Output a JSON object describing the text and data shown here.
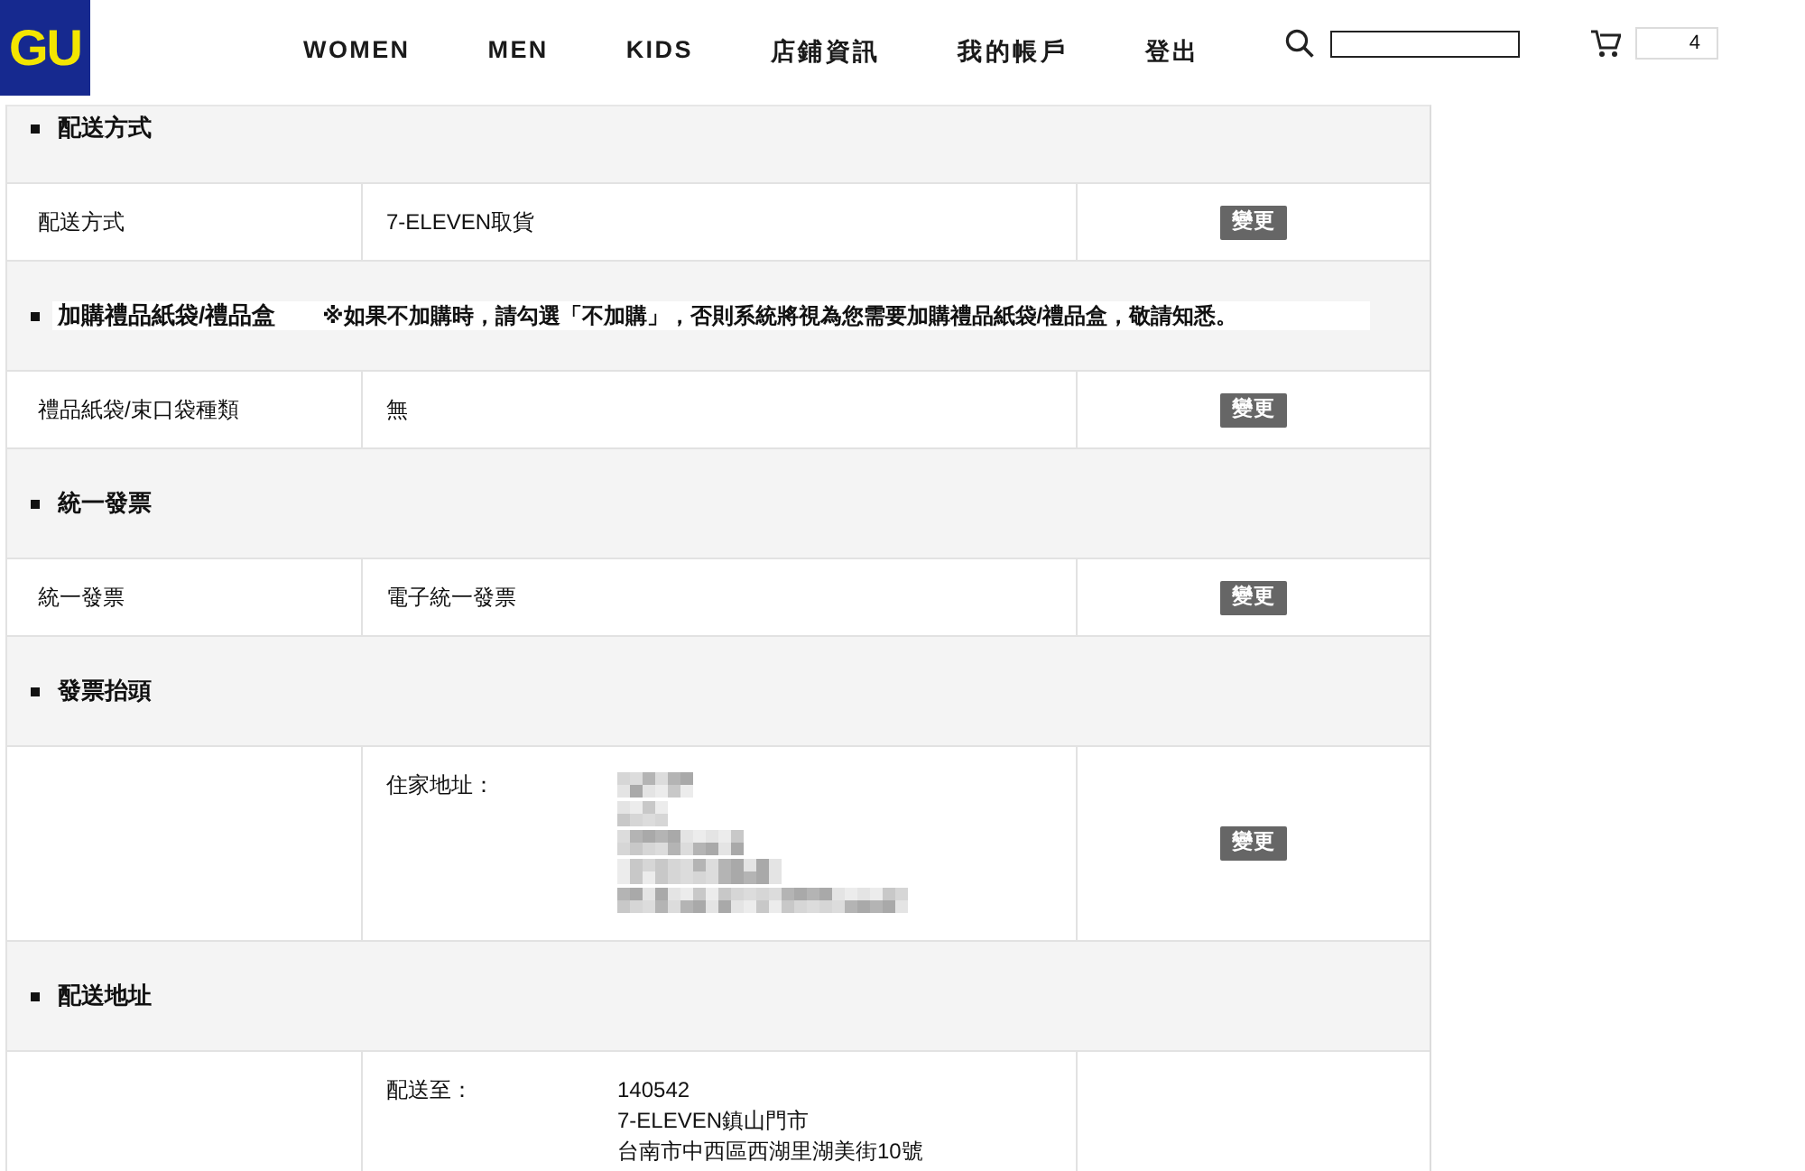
{
  "header": {
    "logo": "GU",
    "nav": [
      {
        "label": "WOMEN"
      },
      {
        "label": "MEN"
      },
      {
        "label": "KIDS"
      },
      {
        "label": "店鋪資訊"
      },
      {
        "label": "我的帳戶"
      },
      {
        "label": "登出"
      }
    ],
    "cart": {
      "count": "4"
    }
  },
  "sections": [
    {
      "title": "配送方式",
      "rows": [
        {
          "label": "配送方式",
          "lines": [
            {
              "kind": "text",
              "text": "7-ELEVEN取貨"
            }
          ],
          "button": "變更"
        }
      ]
    },
    {
      "title": "加購禮品紙袋/禮品盒",
      "note": "※如果不加購時，請勾選「不加購」，否則系統將視為您需要加購禮品紙袋/禮品盒，敬請知悉。",
      "rows": [
        {
          "label": "禮品紙袋/束口袋種類",
          "lines": [
            {
              "kind": "text",
              "text": "無"
            }
          ],
          "button": "變更"
        }
      ]
    },
    {
      "title": "統一發票",
      "rows": [
        {
          "label": "統一發票",
          "lines": [
            {
              "kind": "text",
              "text": "電子統一發票"
            }
          ],
          "button": "變更"
        }
      ]
    },
    {
      "title": "發票抬頭",
      "rows": [
        {
          "field": "住家地址：",
          "lines": [
            {
              "kind": "redacted"
            },
            {
              "kind": "redacted"
            },
            {
              "kind": "redacted"
            },
            {
              "kind": "redacted"
            },
            {
              "kind": "redacted"
            }
          ],
          "button": "變更"
        }
      ]
    },
    {
      "title": "配送地址",
      "rows": [
        {
          "field": "配送至：",
          "lines": [
            {
              "kind": "text",
              "text": "140542"
            },
            {
              "kind": "text",
              "text": "7-ELEVEN鎮山門市"
            },
            {
              "kind": "text",
              "text": "台南市中西區西湖里湖美街10號"
            }
          ]
        }
      ]
    }
  ]
}
